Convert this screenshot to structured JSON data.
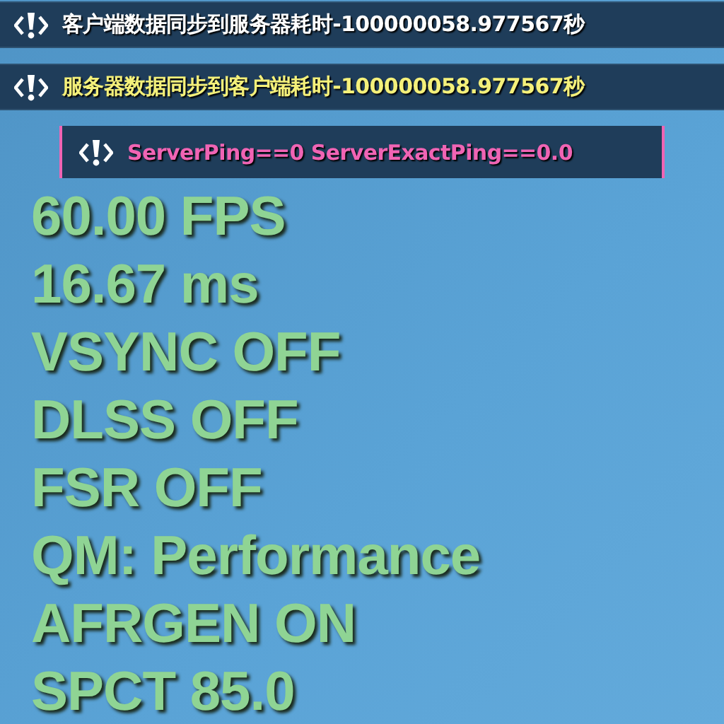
{
  "notices": [
    {
      "kind": "wide",
      "text": "客户端数据同步到服务器耗时-100000058.977567秒",
      "color": "#ffffff"
    },
    {
      "kind": "wide",
      "text": "服务器数据同步到客户端耗时-100000058.977567秒",
      "color": "#f4f07a"
    },
    {
      "kind": "bracketed",
      "text": "ServerPing==0 ServerExactPing==0.0",
      "color": "#f064b4"
    }
  ],
  "stats": [
    "60.00 FPS",
    "16.67 ms",
    "VSYNC OFF",
    "DLSS OFF",
    "FSR OFF",
    "QM: Performance",
    "AFRGEN ON",
    "SPCT 85.0"
  ]
}
